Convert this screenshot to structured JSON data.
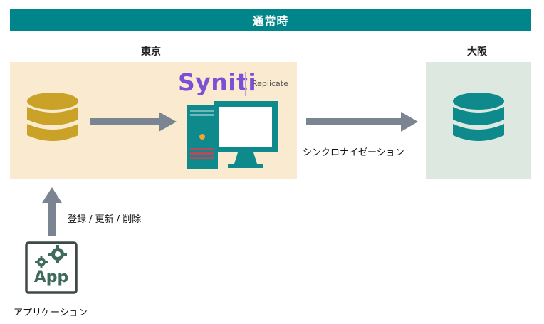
{
  "header": {
    "title": "通常時"
  },
  "regions": {
    "tokyo": "東京",
    "osaka": "大阪"
  },
  "logo": {
    "name": "Syniti",
    "product": "Replicate"
  },
  "labels": {
    "sync": "シンクロナイゼーション",
    "operations": "登録 / 更新 / 削除",
    "app_caption": "アプリケーション",
    "app_icon_text": "App"
  },
  "colors": {
    "teal": "#00868a",
    "database_gold": "#c9a227",
    "database_teal": "#0f8a8c",
    "arrow_gray": "#7b8591",
    "tokyo_bg": "#faebd0",
    "osaka_bg": "#dde9e0",
    "logo_purple": "#7d4fd6",
    "app_green": "#3f6b5e"
  }
}
